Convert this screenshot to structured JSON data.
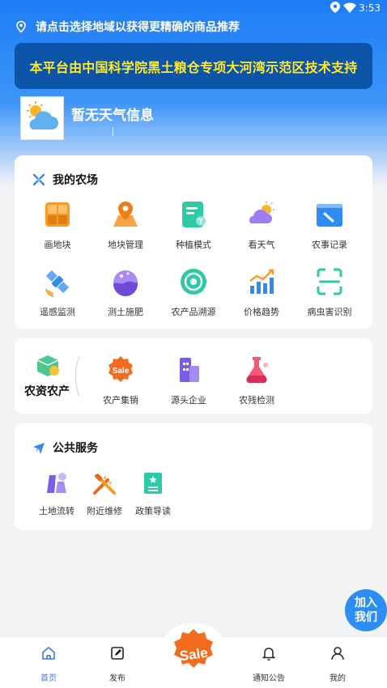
{
  "status_bar": {
    "time": "3:53"
  },
  "location": {
    "prompt": "请点击选择地域以获得更精确的商品推荐"
  },
  "banner": {
    "text": "本平台由中国科学院黑土粮仓专项大河湾示范区技术支持"
  },
  "weather": {
    "text": "暂无天气信息"
  },
  "my_farm": {
    "title": "我的农场",
    "items": [
      {
        "label": "画地块",
        "icon": "plot-draw-icon"
      },
      {
        "label": "地块管理",
        "icon": "map-pin-icon"
      },
      {
        "label": "种植模式",
        "icon": "planting-doc-icon"
      },
      {
        "label": "看天气",
        "icon": "weather-icon"
      },
      {
        "label": "农事记录",
        "icon": "record-icon"
      },
      {
        "label": "遥感监测",
        "icon": "satellite-icon"
      },
      {
        "label": "测土施肥",
        "icon": "soil-test-icon"
      },
      {
        "label": "农产品溯源",
        "icon": "trace-icon"
      },
      {
        "label": "价格趋势",
        "icon": "chart-icon"
      },
      {
        "label": "病虫害识别",
        "icon": "scan-icon"
      }
    ]
  },
  "agri": {
    "title": "农资农产",
    "items": [
      {
        "label": "农产集销",
        "icon": "sale-icon"
      },
      {
        "label": "源头企业",
        "icon": "building-icon"
      },
      {
        "label": "农残检测",
        "icon": "flask-icon"
      }
    ]
  },
  "public_service": {
    "title": "公共服务",
    "items": [
      {
        "label": "土地流转",
        "icon": "land-transfer-icon"
      },
      {
        "label": "附近维修",
        "icon": "repair-icon"
      },
      {
        "label": "政策导读",
        "icon": "policy-icon"
      }
    ]
  },
  "join_button": {
    "line1": "加入",
    "line2": "我们"
  },
  "tabbar": {
    "items": [
      {
        "label": "首页",
        "icon": "home-icon"
      },
      {
        "label": "发布",
        "icon": "edit-icon"
      },
      {
        "label": "通知公告",
        "icon": "bell-icon"
      },
      {
        "label": "我的",
        "icon": "user-icon"
      }
    ],
    "center_badge": "Sale"
  }
}
